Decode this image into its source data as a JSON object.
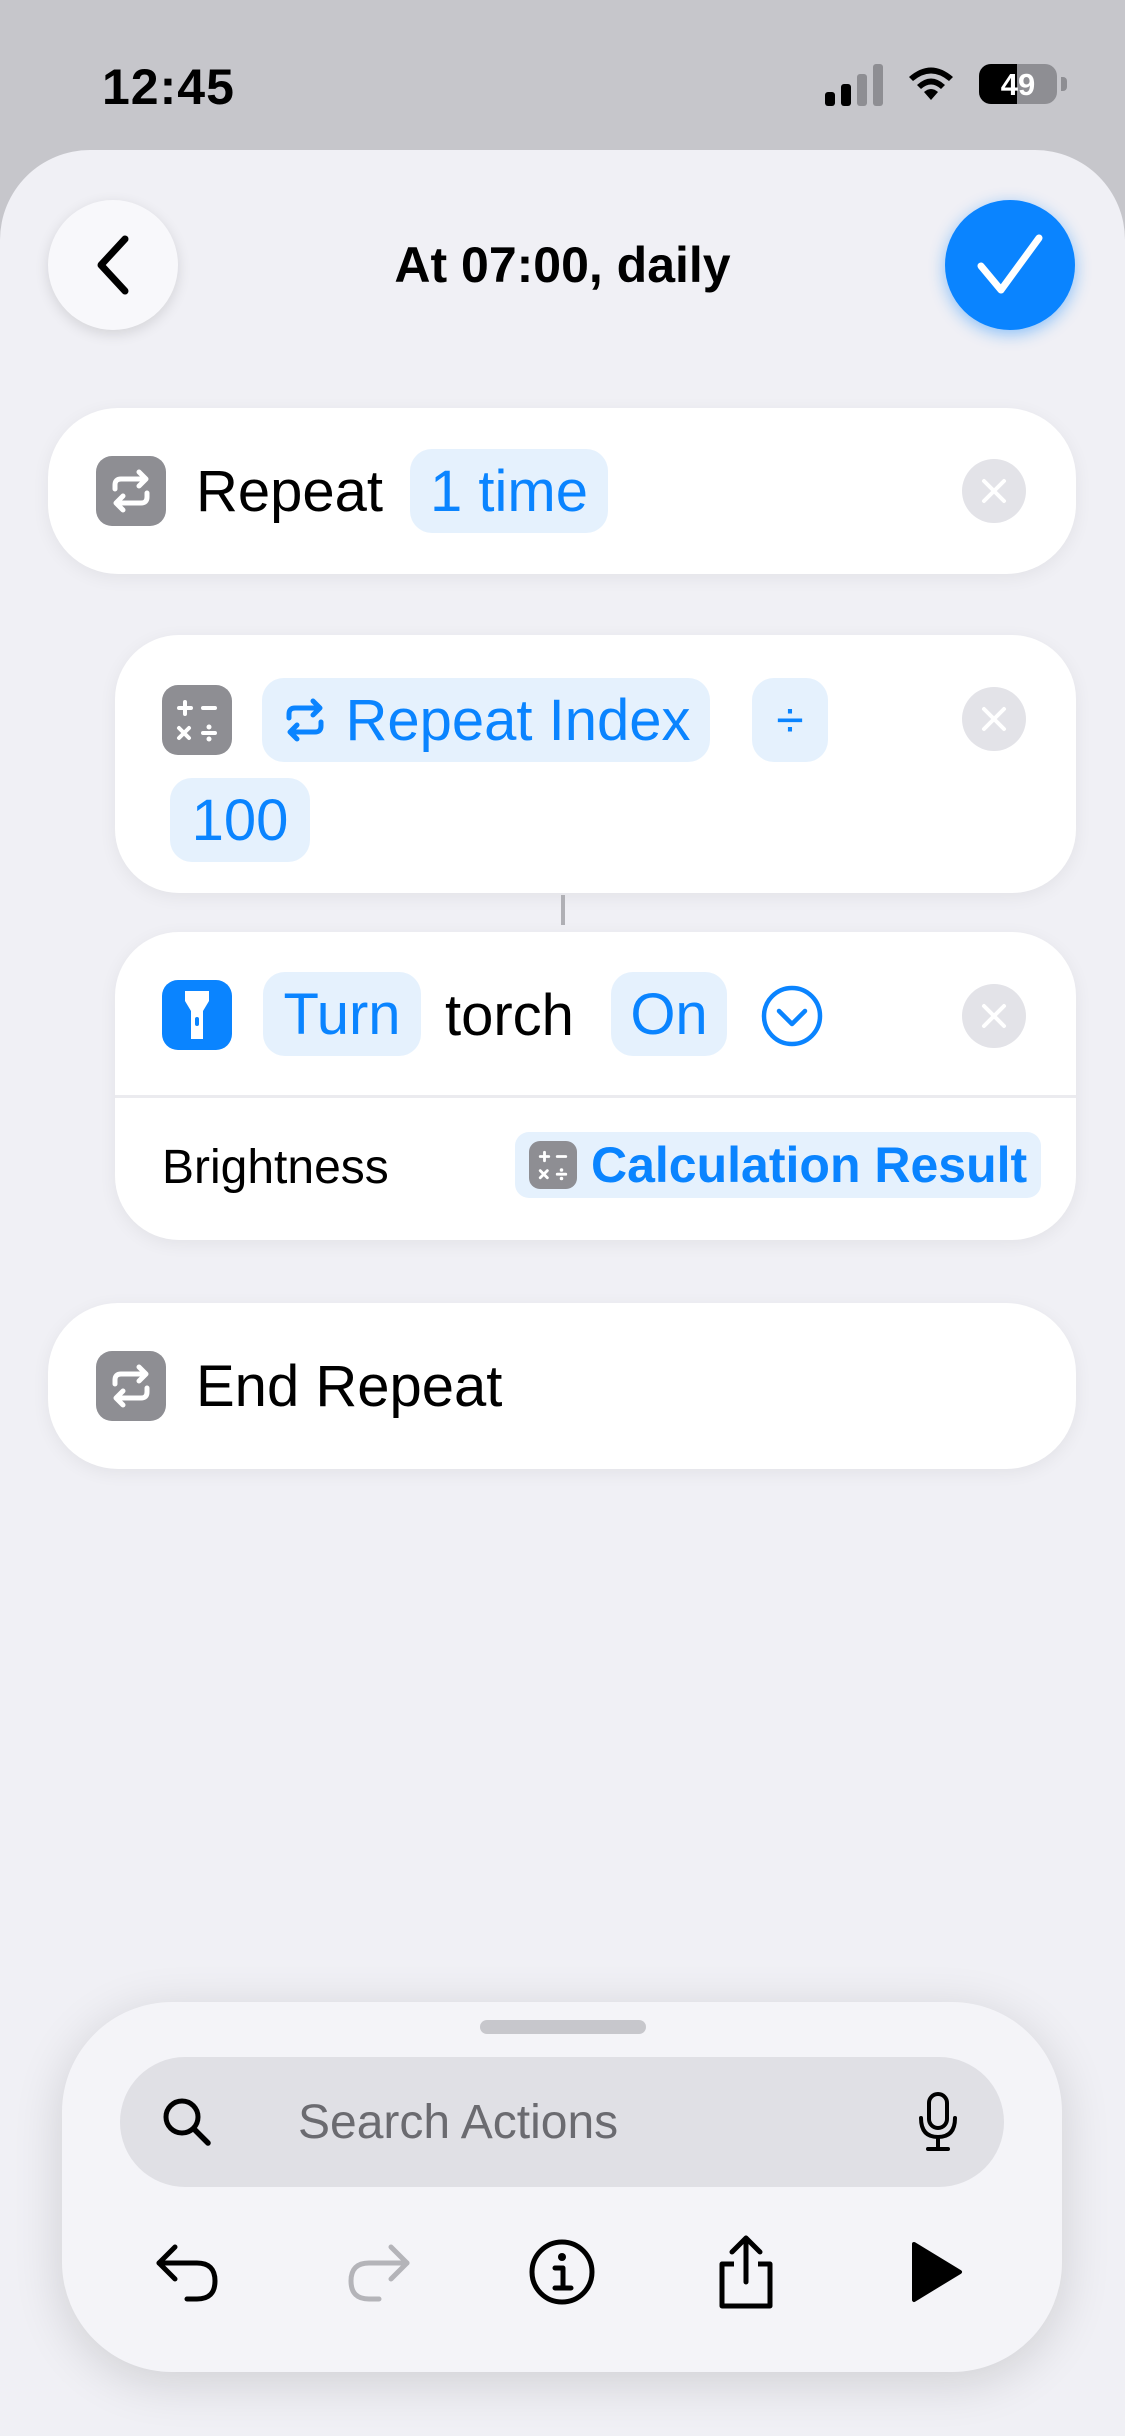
{
  "status_bar": {
    "time": "12:45",
    "battery": "49"
  },
  "nav": {
    "title": "At 07:00, daily"
  },
  "repeat_block": {
    "label": "Repeat",
    "count_label": "1 time"
  },
  "calculate_block": {
    "variable_label": "Repeat Index",
    "operator": "÷",
    "operand": "100"
  },
  "torch_block": {
    "verb": "Turn",
    "object": "torch",
    "state": "On",
    "param_label": "Brightness",
    "param_value": "Calculation Result"
  },
  "end_block": {
    "label": "End Repeat"
  },
  "search": {
    "placeholder": "Search Actions"
  },
  "colors": {
    "accent": "#0a84ff",
    "sheet_bg": "#f0f0f5",
    "pill_bg": "#e5f1fd",
    "icon_gray": "#8e8e93"
  }
}
